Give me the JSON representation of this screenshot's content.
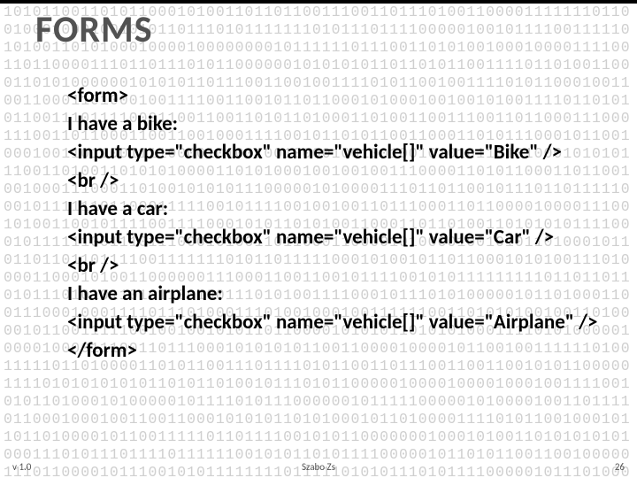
{
  "title": "FORMS",
  "code_lines": [
    "<form>",
    "I have a bike:",
    "<input type=\"checkbox\" name=\"vehicle[]\" value=\"Bike\" />",
    "<br />",
    "I have a car:",
    "<input type=\"checkbox\" name=\"vehicle[]\" value=\"Car\" />",
    "<br />",
    "I have an airplane:",
    "<input type=\"checkbox\" name=\"vehicle[]\" value=\"Airplane\" />",
    "</form>"
  ],
  "footer": {
    "version": "v 1.0",
    "author": "Szabo Zs",
    "page": "26"
  },
  "binary_fill": "1010110011010110001010011011011001110011011101001100001111111011001000100010010101101110101111111010111011110000010010111100111110101001101010001000010000000010111111011100110101001000100001111001101100001110110111010110000001010101011011010110011110110100110001101010000001010101101110011001001111010110010011110101100010011001100011010001001111001100101101100010100010010010100111101101010110011101111000110011001101011010001101001100111001101100011100011100110110001100110010001111001011010110011000110101110001011001000100110110011110000101001001000010010010010101011010100010101011100110100110101010000110101000100100100111000011010110001101100100100011100011010010101011100000101000011101101100101110110111110001011111101100011111001011110010010011011100011011000010000111001010011001011110011110001010110101001100011011010011010101011110001011111100111011100010100110110001100001010000100101011010001011011011011011110011111110101101111100010100101101100010101001110100001100010100110000001110001100110010111100101011111111101101101101011101010110101100100111010100111100010111010100000101101000110011100010001111011101000111010010001001111110011010101001001101000010110011111001001001010110110000101010110101010001111010100000100001000011100110111000101010101100110000100001011001001111110100111110110100001101011001110111101011001101110011001100101011000001111010101010101101011010010111010110000010000100001000100111100101011010001010000010111101011100000010111110000010100001001101111011000100010011001100010101011010100010110100001111010110010001011011010000101100111110110111100101011000000010001010011010101010100011101011101111011111100101011010111100000101101011001100100000111011000010111001010111111110111110101011101011110000010111010001100110001100010010011001110011101101010001101000011010000000010100010101111110000100010010111001010001100000011101101110000111000110010011100011110101000101000110001111100001100011000000000011011010100011011001111100100101100111010101100000100011100101010100000011111101100100110000110000110011110011010001010001100011101010100010011100010100111000010000100010011000100100110111100101100110010011010101011001010111111110011010010100011011001011101001101100110010110110100010100010011110010010011111010000100111100111111000010010011000000101100111111101010100000011011010111011010101111011101111011110101111010111001101100111001011100101010100010101101000011110110111010111001001010100110000101000100100010001100100010011001110101001101010001010101100111001101010101011010110100101110101100000100001000010001001"
}
